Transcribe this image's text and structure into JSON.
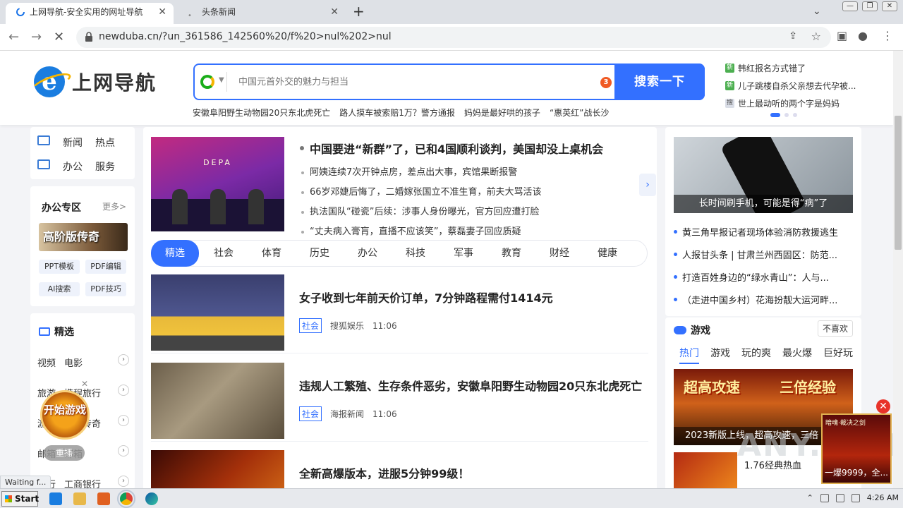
{
  "browser": {
    "tabs": [
      {
        "title": "上网导航-安全实用的网址导航",
        "active": true
      },
      {
        "title": "头条新闻",
        "active": false
      }
    ],
    "url": "newduba.cn/?un_361586_142560%20/f%20>nul%202>nul",
    "status": "Waiting f..."
  },
  "header": {
    "logo_text": "上网导航",
    "search_placeholder": "中国元首外交的魅力与担当",
    "search_badge": "3",
    "search_button": "搜索一下",
    "hot_links": [
      "安徽阜阳野生动物园20只东北虎死亡",
      "路人摸车被索赔1万？警方通报",
      "妈妈是最好哄的孩子",
      "“惠英红”战长沙"
    ],
    "hot_right": [
      {
        "icon": "新",
        "text": "韩红报名方式错了"
      },
      {
        "icon": "新",
        "text": "儿子跳楼自杀父亲想去代孕被..."
      },
      {
        "icon": "搜",
        "text": "世上最动听的两个字是妈妈"
      }
    ]
  },
  "left": {
    "nav": [
      [
        "新闻",
        "热点"
      ],
      [
        "办公",
        "服务"
      ]
    ],
    "office_title": "办公专区",
    "office_more": "更多>",
    "office_banner": "高阶版传奇",
    "office_tags": [
      "PPT模板",
      "PDF编辑",
      "AI搜索",
      "PDF技巧"
    ],
    "featured_title": "精选",
    "featured_rows": [
      [
        "视频",
        "电影"
      ],
      [
        "旅游",
        "携程旅行"
      ],
      [
        "游戏",
        "热血传奇"
      ],
      [
        "邮箱",
        "邮箱"
      ],
      [
        "银行",
        "工商银行"
      ]
    ],
    "game_float": "开始游戏",
    "replay": "重播"
  },
  "center": {
    "lead_headline": "中国要进“新群”了，已和4国顺利谈判，美国却没上桌机会",
    "lead_items": [
      "阿姨连续7次开钟点房，差点出大事，宾馆果断报警",
      "66岁邓婕后悔了，二婚嫁张国立不准生育，前夫大骂活该",
      "执法国队“碰瓷”后续：涉事人身份曝光，官方回应遭打脸",
      "“丈夫病入膏肓，直播不应该笑”，蔡磊妻子回应质疑"
    ],
    "lead_image_text": "DEPA",
    "categories": [
      "精选",
      "社会",
      "体育",
      "历史",
      "办公",
      "科技",
      "军事",
      "教育",
      "财经",
      "健康"
    ],
    "news": [
      {
        "title": "女子收到七年前天价订单，7分钟路程需付1414元",
        "cat": "社会",
        "source": "搜狐娱乐",
        "time": "11:06"
      },
      {
        "title": "违规人工繁殖、生存条件恶劣，安徽阜阳野生动物园20只东北虎死亡",
        "cat": "社会",
        "source": "海报新闻",
        "time": "11:06"
      },
      {
        "title": "全新高爆版本，进服5分钟99级！",
        "cat": "",
        "source": "",
        "time": ""
      }
    ]
  },
  "right": {
    "image_caption": "长时间刷手机，可能是得“病”了",
    "list": [
      "黄三角早报记者现场体验消防救援逃生",
      "人报甘头条 | 甘肃兰州西固区：防范...",
      "打造百姓身边的“绿水青山”：人与...",
      "（走进中国乡村）花海扮靓大运河畔..."
    ],
    "game_title": "游戏",
    "dislike": "不喜欢",
    "game_tabs": [
      "热门",
      "游戏",
      "玩的爽",
      "最火爆",
      "巨好玩"
    ],
    "banner_a": "超高攻速",
    "banner_b": "三倍经验",
    "banner_caption": "2023新版上线，超高攻速，三倍",
    "small_game_text": "1.76经典热血",
    "ad_top": "暗魂·裁决之剑",
    "ad_bottom": "一爆9999，全..."
  },
  "watermark": "ANY.RUN",
  "taskbar": {
    "start": "Start",
    "time": "4:26 AM"
  }
}
